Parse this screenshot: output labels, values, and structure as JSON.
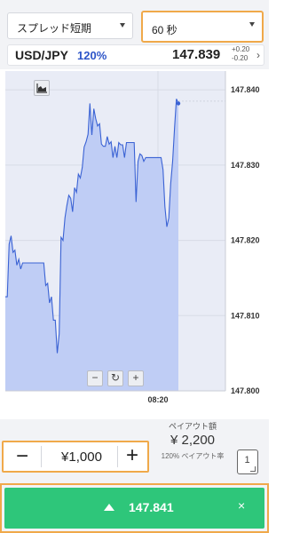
{
  "header": {
    "option_type": "スプレッド短期",
    "duration": "60 秒"
  },
  "pair": {
    "name": "USD/JPY",
    "payout_rate": "120%",
    "price": "147.839",
    "delta_up": "+0.20",
    "delta_down": "-0.20",
    "chevron": "›"
  },
  "chart_controls": {
    "chart_type_icon": "area-chart-icon",
    "zoom_out": "−",
    "reset": "↻",
    "zoom_in": "+"
  },
  "chart_data": {
    "type": "area",
    "title": "",
    "xlabel": "",
    "ylabel": "",
    "x_tick_labels": [
      "08:20"
    ],
    "y_tick_labels": [
      "147.840",
      "147.830",
      "147.820",
      "147.810",
      "147.800"
    ],
    "y_ticks": [
      147.84,
      147.83,
      147.82,
      147.81,
      147.8
    ],
    "ylim": [
      147.8,
      147.8425
    ],
    "grid": true,
    "current_value": 147.8385,
    "series": [
      {
        "values": [
          147.8125,
          147.8125,
          147.8195,
          147.8206,
          147.8184,
          147.8187,
          147.8167,
          147.8175,
          147.8162,
          147.817,
          147.817,
          147.817,
          147.817,
          147.817,
          147.817,
          147.817,
          147.817,
          147.817,
          147.817,
          147.817,
          147.817,
          147.814,
          147.8143,
          147.8117,
          147.8125,
          147.8094,
          147.8094,
          147.805,
          147.8076,
          147.8204,
          147.82,
          147.823,
          147.8246,
          147.826,
          147.8256,
          147.8238,
          147.827,
          147.8264,
          147.8288,
          147.8283,
          147.8297,
          147.8324,
          147.8331,
          147.8341,
          147.8382,
          147.834,
          147.8375,
          147.8362,
          147.8352,
          147.8355,
          147.8328,
          147.8325,
          147.8325,
          147.8338,
          147.8328,
          147.8331,
          147.831,
          147.8325,
          147.831,
          147.833,
          147.8327,
          147.8327,
          147.831,
          147.833,
          147.833,
          147.833,
          147.833,
          147.833,
          147.8251,
          147.8305,
          147.8315,
          147.8313,
          147.8305,
          147.831,
          147.831,
          147.831,
          147.831,
          147.831,
          147.831,
          147.831,
          147.831,
          147.831,
          147.8294,
          147.8245,
          147.8218,
          147.823,
          147.8275,
          147.8305,
          147.835,
          147.8388,
          147.8382
        ]
      }
    ]
  },
  "amount": {
    "minus": "−",
    "value": "¥1,000",
    "plus": "+"
  },
  "payout": {
    "label": "ペイアウト額",
    "value": "¥ 2,200",
    "rate_text": "120% ペイアウト率"
  },
  "multi_button": {
    "label": "1"
  },
  "buy": {
    "price": "147.841",
    "close": "×"
  },
  "colors": {
    "buy_green": "#2ec67a",
    "highlight_orange": "#f0a94a",
    "accent_blue": "#2d55c8",
    "series_line": "#3a62d4",
    "series_fill": "#bfcdf5"
  }
}
